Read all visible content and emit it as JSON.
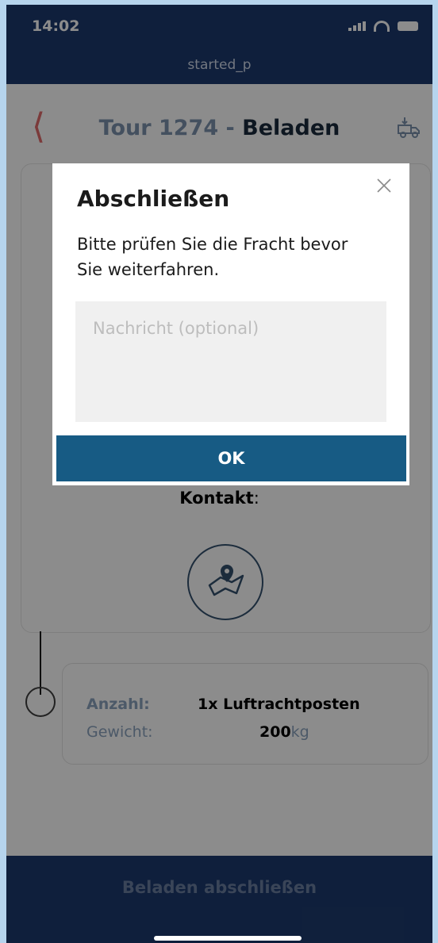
{
  "status_bar": {
    "time": "14:02"
  },
  "app_header": {
    "subtitle": "started_p"
  },
  "nav": {
    "tour_prefix": "Tour 1274 - ",
    "tour_status": "Beladen"
  },
  "stop_card": {
    "contact_label": "Kontakt",
    "contact_colon": ":"
  },
  "item": {
    "anzahl_label": "Anzahl:",
    "anzahl_value": "1x Luftrachtposten",
    "gewicht_label": "Gewicht:",
    "gewicht_value": "200",
    "gewicht_unit": "kg"
  },
  "bottom_action": {
    "label": "Beladen abschließen"
  },
  "modal": {
    "title": "Abschließen",
    "text": "Bitte prüfen Sie die Fracht bevor Sie weiterfahren.",
    "message_placeholder": "Nachricht (optional)",
    "message_value": "",
    "ok_label": "OK"
  },
  "colors": {
    "background": "#b6d4ed",
    "header_navy": "#1d3a6e",
    "ok_button": "#175b84",
    "back_arrow": "#e06a6a"
  }
}
